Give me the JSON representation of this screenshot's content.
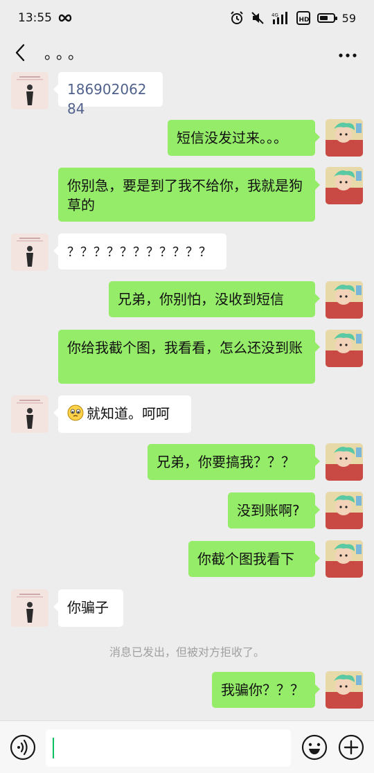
{
  "status_bar": {
    "time": "13:55",
    "battery": "59",
    "battery_level": 0.59,
    "network": "4G",
    "hd": "HD"
  },
  "header": {
    "title": "。。。",
    "back_icon": "chevron-left-icon",
    "more_icon": "more-dots-icon"
  },
  "messages": [
    {
      "side": "left",
      "text": "18690206284",
      "kind": "phone"
    },
    {
      "side": "right",
      "text": "短信没发过来。。。"
    },
    {
      "side": "right",
      "text": "你别急，要是到了我不给你，我就是狗草的"
    },
    {
      "side": "left",
      "text": "？？？？？？？？？？？"
    },
    {
      "side": "right",
      "text": "兄弟，你别怕，没收到短信"
    },
    {
      "side": "right",
      "text": "你给我截个图，我看看，怎么还没到账"
    },
    {
      "side": "left",
      "text": "就知道。呵呵",
      "emoji": "pleading-face-icon"
    },
    {
      "side": "right",
      "text": "兄弟，你要搞我？？？"
    },
    {
      "side": "right",
      "text": "没到账啊?"
    },
    {
      "side": "right",
      "text": "你截个图我看下"
    },
    {
      "side": "left",
      "text": "你骗子"
    },
    {
      "side": "right",
      "text": "我骗你？？？"
    }
  ],
  "system_note": "消息已发出，但被对方拒收了。",
  "input_bar": {
    "voice_icon": "voice-icon",
    "input_value": "",
    "emoji_icon": "emoji-smile-icon",
    "plus_icon": "plus-circle-icon"
  }
}
